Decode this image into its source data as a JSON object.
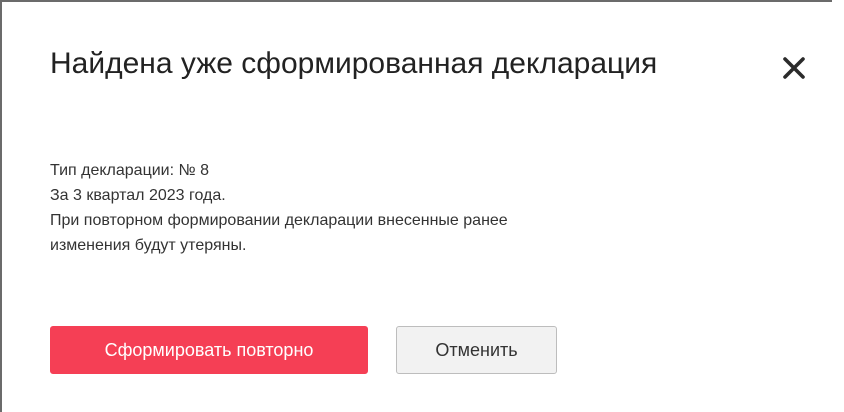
{
  "dialog": {
    "title": "Найдена уже сформированная декларация",
    "close_icon": "close-icon",
    "message": {
      "type_line": "Тип декларации: № 8",
      "period_line": "За 3 квартал 2023 года.",
      "warning_line_1": "При повторном формировании декларации внесенные ранее",
      "warning_line_2": "изменения будут утеряны."
    },
    "buttons": {
      "regenerate_label": "Сформировать повторно",
      "cancel_label": "Отменить"
    }
  },
  "colors": {
    "primary_button": "#f53f55",
    "secondary_button": "#f2f2f2",
    "title_text": "#222222",
    "body_text": "#333333"
  }
}
